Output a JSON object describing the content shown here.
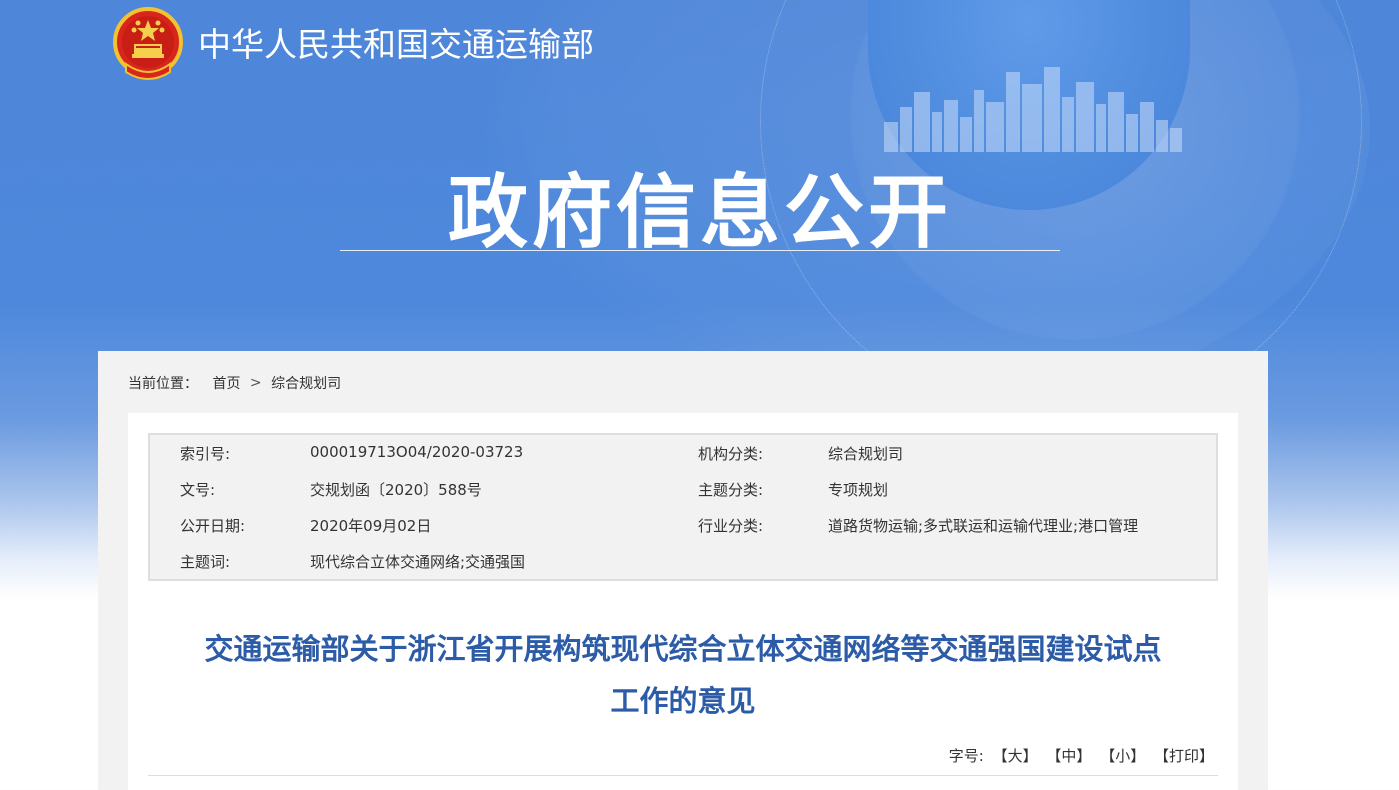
{
  "header": {
    "ministry_name": "中华人民共和国交通运输部",
    "hero_title": "政府信息公开"
  },
  "breadcrumb": {
    "label": "当前位置：",
    "home": "首页",
    "separator": ">",
    "current": "综合规划司"
  },
  "meta": {
    "index_label": "索引号:",
    "index_value": "000019713O04/2020-03723",
    "org_label": "机构分类:",
    "org_value": "综合规划司",
    "docno_label": "文号:",
    "docno_value": "交规划函〔2020〕588号",
    "topic_label": "主题分类:",
    "topic_value": "专项规划",
    "date_label": "公开日期:",
    "date_value": "2020年09月02日",
    "industry_label": "行业分类:",
    "industry_value": "道路货物运输;多式联运和运输代理业;港口管理",
    "keywords_label": "主题词:",
    "keywords_value": "现代综合立体交通网络;交通强国"
  },
  "document": {
    "title_line1": "交通运输部关于浙江省开展构筑现代综合立体交通网络等交通强国建设试点",
    "title_line2": "工作的意见"
  },
  "font_tools": {
    "label": "字号:",
    "large": "【大】",
    "medium": "【中】",
    "small": "【小】",
    "print": "【打印】"
  },
  "colors": {
    "banner_blue": "#4e86d9",
    "title_blue": "#2c5ba7",
    "panel_gray": "#f2f2f2"
  }
}
